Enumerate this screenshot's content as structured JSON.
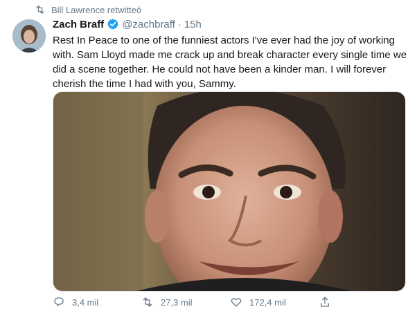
{
  "retweet_context": {
    "label": "Bill Lawrence retwitteó"
  },
  "tweet": {
    "author_name": "Zach Braff",
    "handle": "@zachbraff",
    "separator": "·",
    "timestamp": "15h",
    "text": "Rest In Peace to one of the funniest actors I've ever had the joy of working with. Sam Lloyd made me crack up and break character every single time we did a scene together. He could not have been a kinder man. I will forever cherish the time I had with you, Sammy."
  },
  "actions": {
    "replies": "3,4 mil",
    "retweets": "27,3 mil",
    "likes": "172,4 mil"
  },
  "icons": {
    "retweet_context": "retweet-icon",
    "verified": "verified-badge-icon",
    "reply": "reply-icon",
    "retweet": "retweet-icon",
    "like": "heart-icon",
    "share": "share-icon"
  },
  "colors": {
    "text": "#14171a",
    "secondary_text": "#657786",
    "verified_blue": "#1da1f2"
  }
}
